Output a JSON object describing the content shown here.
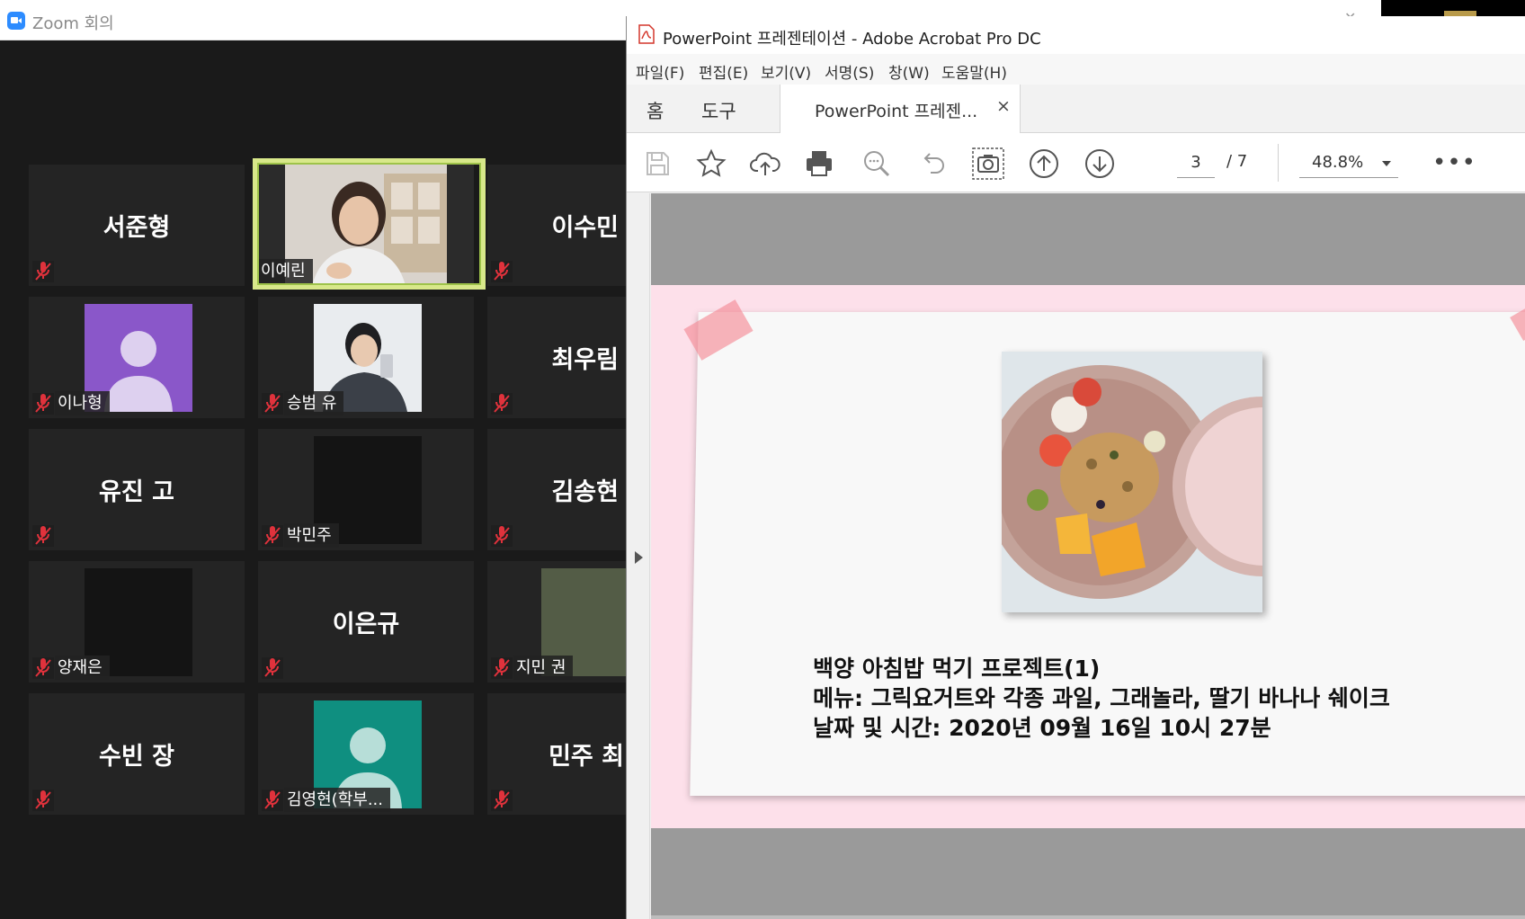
{
  "zoom": {
    "title": "Zoom 회의",
    "participants": [
      {
        "name": "서준형",
        "label": ""
      },
      {
        "name": "",
        "label": "이예린"
      },
      {
        "name": "이수민",
        "label": ""
      },
      {
        "name": "",
        "label": "이나형"
      },
      {
        "name": "",
        "label": "승범 유"
      },
      {
        "name": "최우림",
        "label": ""
      },
      {
        "name": "유진 고",
        "label": ""
      },
      {
        "name": "",
        "label": "박민주"
      },
      {
        "name": "김송현",
        "label": ""
      },
      {
        "name": "",
        "label": "양재은"
      },
      {
        "name": "이은규",
        "label": ""
      },
      {
        "name": "",
        "label": "지민 권"
      },
      {
        "name": "수빈 장",
        "label": ""
      },
      {
        "name": "",
        "label": "김영현(학부..."
      },
      {
        "name": "민주 최",
        "label": ""
      }
    ],
    "colors": {
      "active_speaker_border": "#d8e88a",
      "mute_icon": "#e0323c",
      "avatar_purple": "#8a57c9",
      "avatar_teal": "#0f8f80"
    }
  },
  "acrobat": {
    "title": "PowerPoint 프레젠테이션 - Adobe Acrobat Pro DC",
    "menu": [
      "파일(F)",
      "편집(E)",
      "보기(V)",
      "서명(S)",
      "창(W)",
      "도움말(H)"
    ],
    "tabs": {
      "home": "홈",
      "tools": "도구",
      "document": "PowerPoint 프레젠...",
      "close": "×"
    },
    "toolbar_icons": [
      "save-icon",
      "bookmark-star-icon",
      "cloud-upload-icon",
      "print-icon",
      "zoom-search-icon",
      "undo-icon",
      "snapshot-camera-icon",
      "page-up-icon",
      "page-down-icon"
    ],
    "page_current": "3",
    "page_total": "/ 7",
    "zoom_level": "48.8%",
    "more": "•••",
    "slide": {
      "lines": [
        "백양 아침밥 먹기 프로젝트(1)",
        "메뉴: 그릭요거트와 각종 과일, 그래놀라, 딸기 바나나 쉐이크",
        "날짜 및 시간: 2020년 09월 16일 10시 27분"
      ]
    }
  }
}
